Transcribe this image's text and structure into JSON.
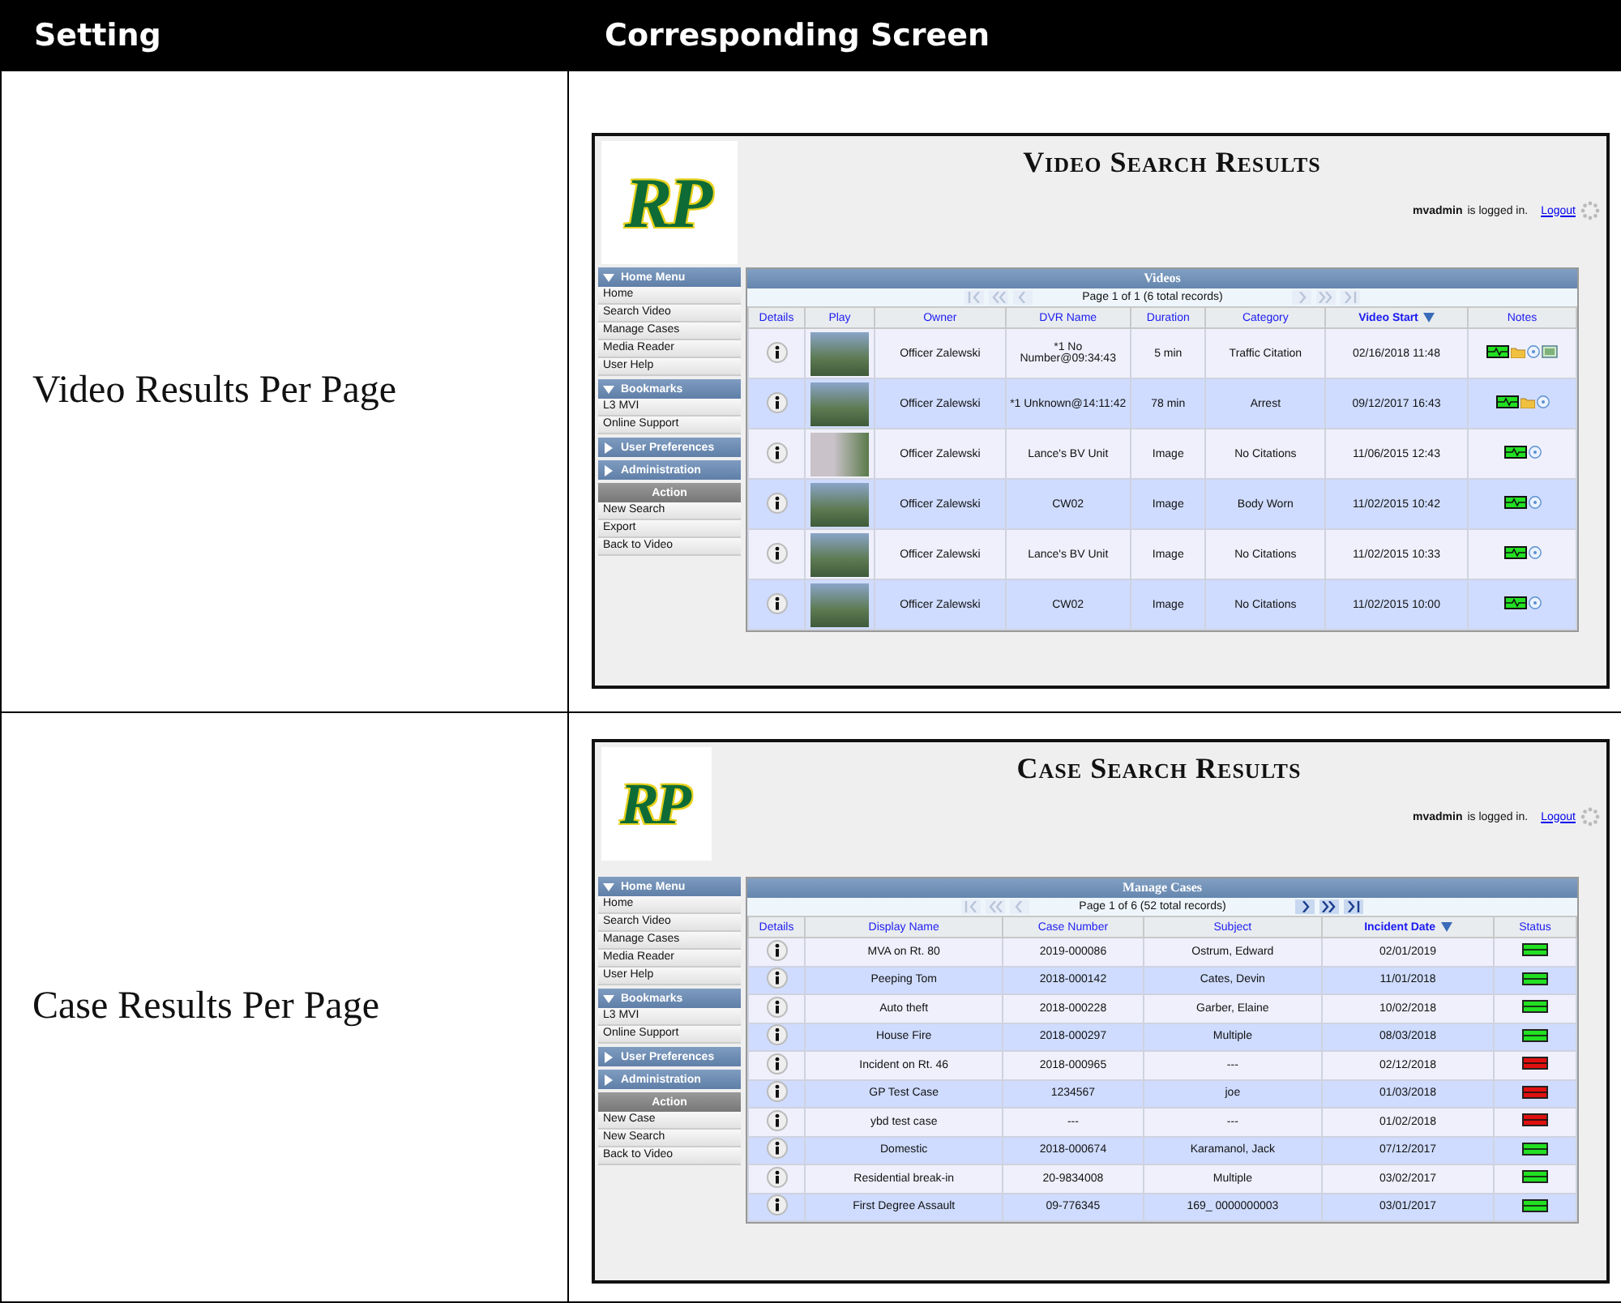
{
  "header": {
    "setting": "Setting",
    "screen": "Corresponding Screen"
  },
  "rows": [
    {
      "setting": "Video Results Per Page",
      "screen": {
        "logo": "RP",
        "title": "Video Search Results",
        "user": "mvadmin",
        "logged_text": "is logged in.",
        "logout": "Logout",
        "menu": [
          {
            "kind": "section",
            "label": "Home Menu",
            "expanded": true,
            "items": [
              "Home",
              "Search Video",
              "Manage Cases",
              "Media Reader",
              "User Help"
            ]
          },
          {
            "kind": "section",
            "label": "Bookmarks",
            "expanded": true,
            "items": [
              "L3 MVI",
              "Online Support"
            ]
          },
          {
            "kind": "section",
            "label": "User Preferences",
            "expanded": false
          },
          {
            "kind": "section",
            "label": "Administration",
            "expanded": false
          },
          {
            "kind": "action",
            "label": "Action",
            "items": [
              "New Search",
              "Export",
              "Back to Video"
            ]
          }
        ],
        "table": {
          "kind": "video",
          "title": "Videos",
          "pager": {
            "text": "Page 1 of 1 (6 total records)",
            "prev_enabled": false,
            "next_enabled": false
          },
          "columns": [
            {
              "label": "Details",
              "kind": "details",
              "sorted": false
            },
            {
              "label": "Play",
              "kind": "thumb",
              "sorted": false
            },
            {
              "label": "Owner",
              "kind": "text",
              "sorted": false
            },
            {
              "label": "DVR Name",
              "kind": "text",
              "sorted": false
            },
            {
              "label": "Duration",
              "kind": "text",
              "sorted": false
            },
            {
              "label": "Category",
              "kind": "text",
              "sorted": false
            },
            {
              "label": "Video Start",
              "kind": "text",
              "sorted": true
            },
            {
              "label": "Notes",
              "kind": "notes",
              "sorted": false
            }
          ],
          "rows": [
            {
              "cells": [
                "",
                "",
                "Officer Zalewski",
                "*1 No Number@09:34:43",
                "5 min",
                "Traffic Citation",
                "02/16/2018 11:48",
                ""
              ],
              "notes": {
                "folder": true,
                "disc": true,
                "media": true
              }
            },
            {
              "cells": [
                "",
                "",
                "Officer Zalewski",
                "*1 Unknown@14:11:42",
                "78 min",
                "Arrest",
                "09/12/2017 16:43",
                ""
              ],
              "notes": {
                "folder": true,
                "disc": true,
                "media": false
              }
            },
            {
              "cells": [
                "",
                "",
                "Officer Zalewski",
                "Lance's BV Unit",
                "Image",
                "No Citations",
                "11/06/2015 12:43",
                ""
              ],
              "notes": {
                "folder": false,
                "disc": true,
                "media": false
              }
            },
            {
              "cells": [
                "",
                "",
                "Officer Zalewski",
                "CW02",
                "Image",
                "Body Worn",
                "11/02/2015 10:42",
                ""
              ],
              "notes": {
                "folder": false,
                "disc": true,
                "media": false
              }
            },
            {
              "cells": [
                "",
                "",
                "Officer Zalewski",
                "Lance's BV Unit",
                "Image",
                "No Citations",
                "11/02/2015 10:33",
                ""
              ],
              "notes": {
                "folder": false,
                "disc": true,
                "media": false
              }
            },
            {
              "cells": [
                "",
                "",
                "Officer Zalewski",
                "CW02",
                "Image",
                "No Citations",
                "11/02/2015 10:00",
                ""
              ],
              "notes": {
                "folder": false,
                "disc": true,
                "media": false
              }
            }
          ]
        }
      }
    },
    {
      "setting": "Case Results Per Page",
      "screen": {
        "logo": "RP",
        "title": "Case Search Results",
        "user": "mvadmin",
        "logged_text": "is logged in.",
        "logout": "Logout",
        "menu": [
          {
            "kind": "section",
            "label": "Home Menu",
            "expanded": true,
            "items": [
              "Home",
              "Search Video",
              "Manage Cases",
              "Media Reader",
              "User Help"
            ]
          },
          {
            "kind": "section",
            "label": "Bookmarks",
            "expanded": true,
            "items": [
              "L3 MVI",
              "Online Support"
            ]
          },
          {
            "kind": "section",
            "label": "User Preferences",
            "expanded": false
          },
          {
            "kind": "section",
            "label": "Administration",
            "expanded": false
          },
          {
            "kind": "action",
            "label": "Action",
            "items": [
              "New Case",
              "New Search",
              "Back to Video"
            ]
          }
        ],
        "table": {
          "kind": "case",
          "title": "Manage Cases",
          "pager": {
            "text": "Page 1 of 6 (52 total records)",
            "prev_enabled": false,
            "next_enabled": true
          },
          "columns": [
            {
              "label": "Details",
              "kind": "details",
              "sorted": false
            },
            {
              "label": "Display Name",
              "kind": "text",
              "sorted": false
            },
            {
              "label": "Case Number",
              "kind": "text",
              "sorted": false
            },
            {
              "label": "Subject",
              "kind": "text",
              "sorted": false
            },
            {
              "label": "Incident Date",
              "kind": "text",
              "sorted": true
            },
            {
              "label": "Status",
              "kind": "status",
              "sorted": false
            }
          ],
          "rows": [
            {
              "cells": [
                "",
                "MVA on Rt. 80",
                "2019-000086",
                "Ostrum, Edward",
                "02/01/2019",
                ""
              ],
              "color": "#22e022"
            },
            {
              "cells": [
                "",
                "Peeping Tom",
                "2018-000142",
                "Cates, Devin",
                "11/01/2018",
                ""
              ],
              "color": "#22e022"
            },
            {
              "cells": [
                "",
                "Auto theft",
                "2018-000228",
                "Garber, Elaine",
                "10/02/2018",
                ""
              ],
              "color": "#22e022"
            },
            {
              "cells": [
                "",
                "House Fire",
                "2018-000297",
                "Multiple",
                "08/03/2018",
                ""
              ],
              "color": "#22e022"
            },
            {
              "cells": [
                "",
                "Incident on Rt. 46",
                "2018-000965",
                "---",
                "02/12/2018",
                ""
              ],
              "color": "#e01010"
            },
            {
              "cells": [
                "",
                "GP Test Case",
                "1234567",
                "joe",
                "01/03/2018",
                ""
              ],
              "color": "#e01010"
            },
            {
              "cells": [
                "",
                "ybd test case",
                "---",
                "---",
                "01/02/2018",
                ""
              ],
              "color": "#e01010"
            },
            {
              "cells": [
                "",
                "Domestic",
                "2018-000674",
                "Karamanol, Jack",
                "07/12/2017",
                ""
              ],
              "color": "#22e022"
            },
            {
              "cells": [
                "",
                "Residential break-in",
                "20-9834008",
                "Multiple",
                "03/02/2017",
                ""
              ],
              "color": "#22e022"
            },
            {
              "cells": [
                "",
                "First Degree Assault",
                "09-776345",
                "169_ 0000000003",
                "03/01/2017",
                ""
              ],
              "color": "#22e022"
            }
          ]
        }
      }
    }
  ]
}
